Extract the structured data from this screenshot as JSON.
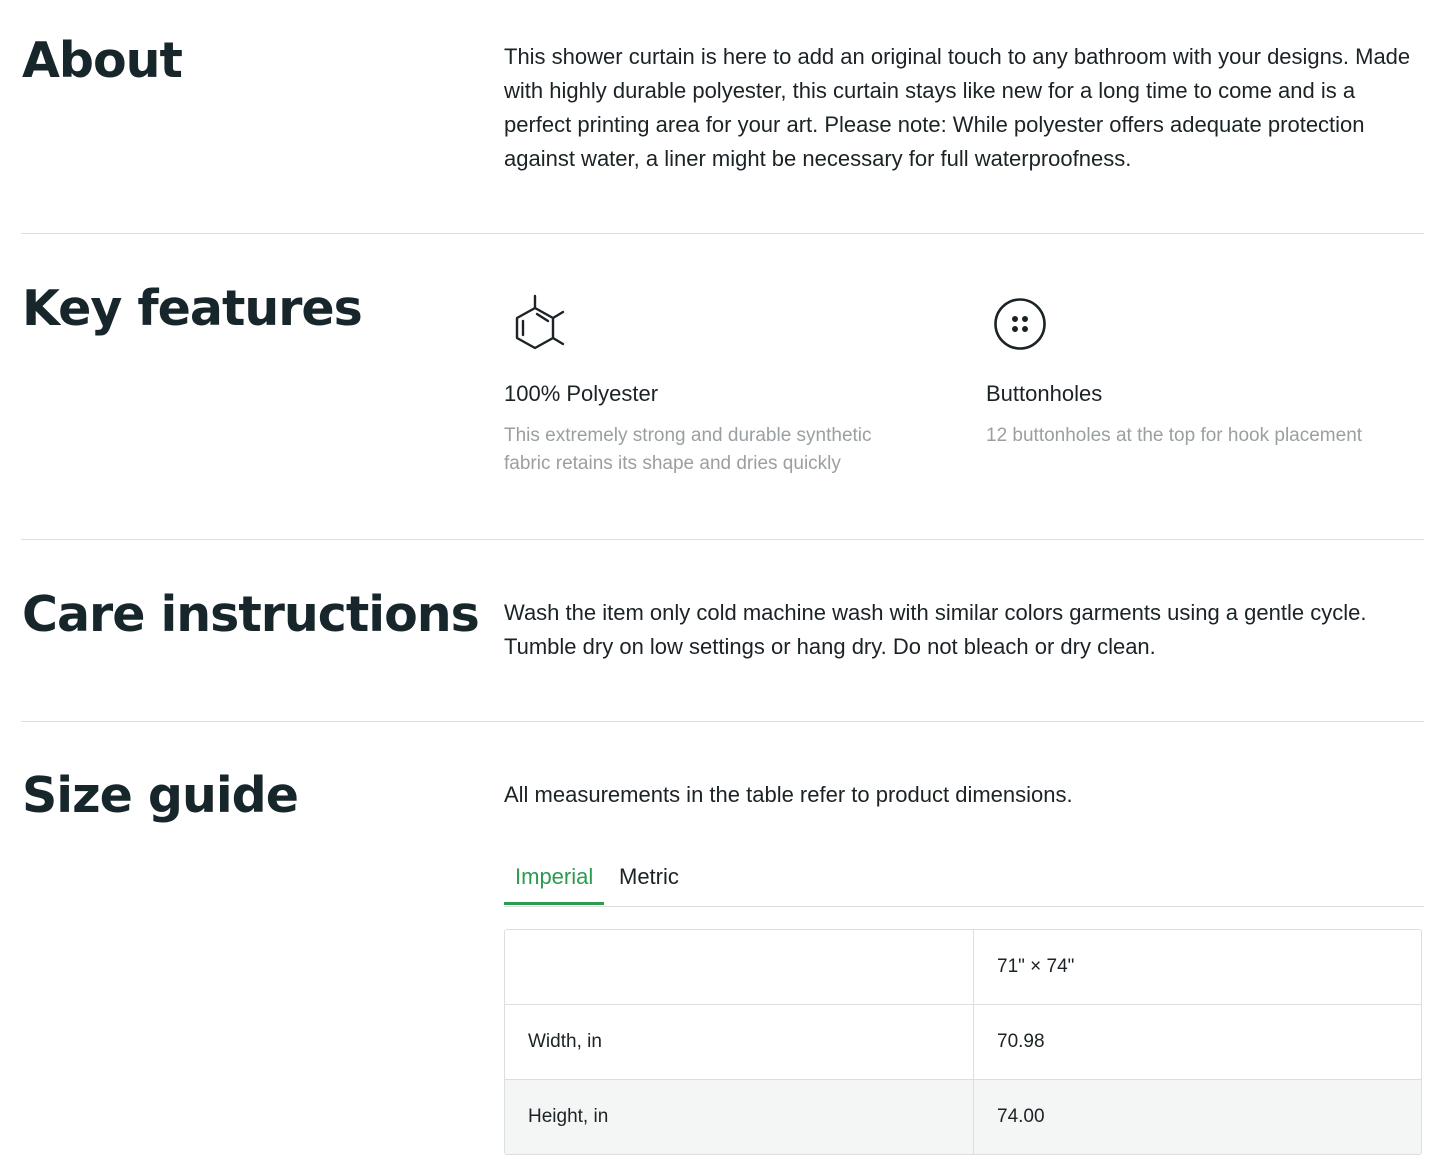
{
  "about": {
    "title": "About",
    "text": "This shower curtain is here to add an original touch to any bathroom with your designs. Made with highly durable polyester, this curtain stays like new for a long time to come and is a perfect printing area for your art. Please note: While polyester offers adequate protection against water, a liner might be necessary for full waterproofness."
  },
  "key_features": {
    "title": "Key features",
    "items": [
      {
        "icon": "molecule-icon",
        "title": "100% Polyester",
        "description": "This extremely strong and durable synthetic fabric retains its shape and dries quickly"
      },
      {
        "icon": "button-icon",
        "title": "Buttonholes",
        "description": "12 buttonholes at the top for hook placement"
      }
    ]
  },
  "care": {
    "title": "Care instructions",
    "text": "Wash the item only cold machine wash with similar colors garments using a gentle cycle. Tumble dry on low settings or hang dry. Do not bleach or dry clean."
  },
  "size_guide": {
    "title": "Size guide",
    "note": "All measurements in the table refer to product dimensions.",
    "tabs": [
      {
        "label": "Imperial",
        "active": true
      },
      {
        "label": "Metric",
        "active": false
      }
    ],
    "table": {
      "header": [
        "",
        "71\" × 74\""
      ],
      "rows": [
        [
          "Width, in",
          "70.98"
        ],
        [
          "Height, in",
          "74.00"
        ]
      ]
    }
  },
  "colors": {
    "accent": "#2c9b4f",
    "text": "#1b2326",
    "muted": "#9a9fa1",
    "divider": "#dcdfe0",
    "row_shade": "#f4f5f5"
  }
}
